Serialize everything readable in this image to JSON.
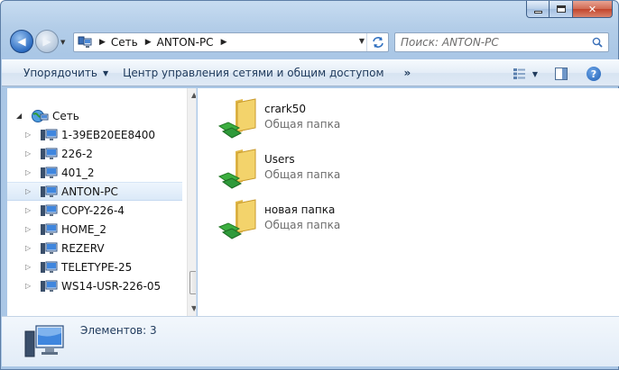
{
  "window": {
    "controls": [
      "minimize",
      "maximize",
      "close"
    ]
  },
  "navigation": {
    "back_icon": "back-arrow-icon",
    "forward_icon": "forward-arrow-icon",
    "breadcrumbs": [
      "Сеть",
      "ANTON-PC"
    ],
    "search_placeholder": "Поиск: ANTON-PC"
  },
  "toolbar": {
    "organize_label": "Упорядочить",
    "network_center_label": "Центр управления сетями и общим доступом",
    "more_label": "»",
    "view_icon": "view-options-icon",
    "preview_icon": "preview-pane-icon",
    "help_icon": "help-icon"
  },
  "sidebar": {
    "root_label": "Сеть",
    "items": [
      {
        "label": "1-39EB20EE8400"
      },
      {
        "label": "226-2"
      },
      {
        "label": "401_2"
      },
      {
        "label": "ANTON-PC",
        "selected": true
      },
      {
        "label": "COPY-226-4"
      },
      {
        "label": "HOME_2"
      },
      {
        "label": "REZERV"
      },
      {
        "label": "TELETYPE-25"
      },
      {
        "label": "WS14-USR-226-05"
      }
    ]
  },
  "content": {
    "items": [
      {
        "name": "crark50",
        "type": "Общая папка"
      },
      {
        "name": "Users",
        "type": "Общая папка"
      },
      {
        "name": "новая папка",
        "type": "Общая папка"
      }
    ]
  },
  "details": {
    "text": "Элементов: 3",
    "icon": "computer-icon"
  },
  "colors": {
    "frame": "#aac7e6",
    "command_text": "#1e395b",
    "selection": "#dbe9f8",
    "folder": "#f3d36b",
    "share_arrow": "#3cae3f"
  }
}
